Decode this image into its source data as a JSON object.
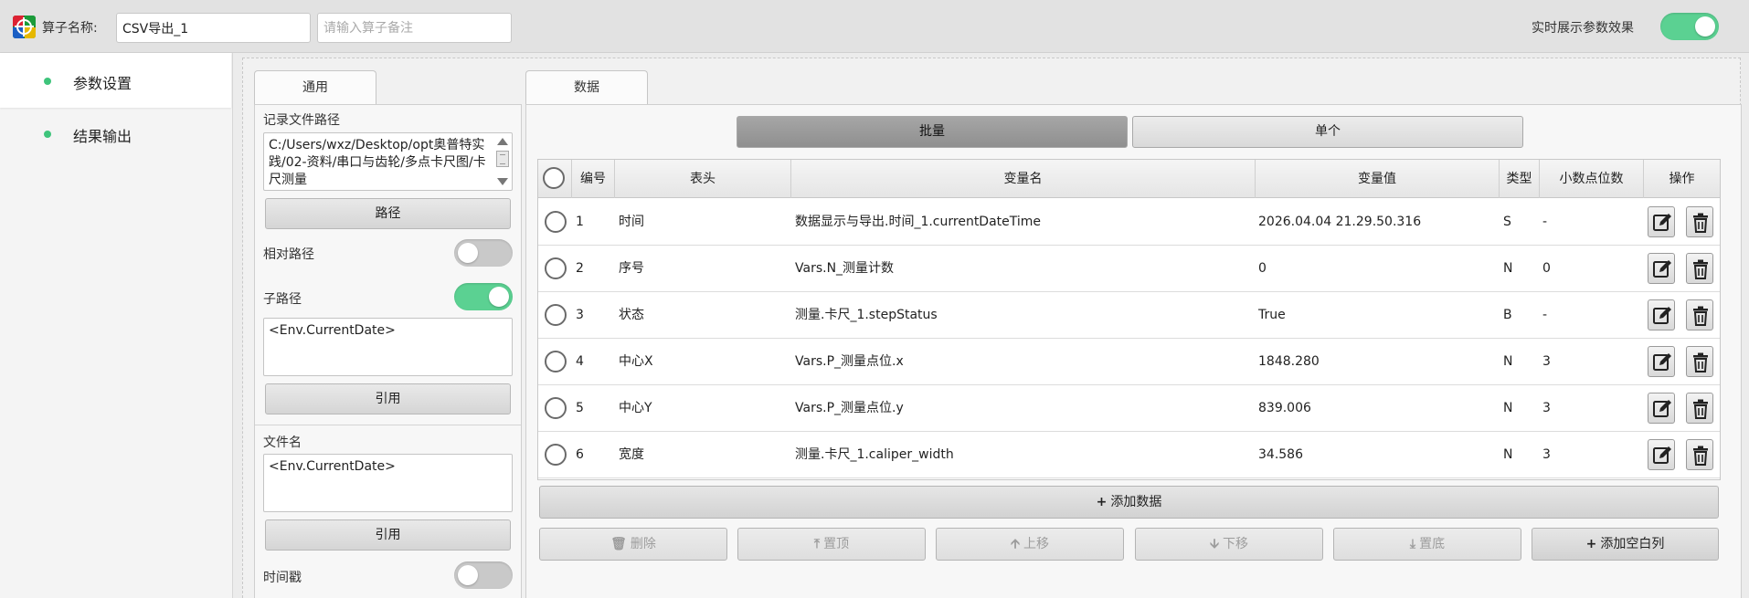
{
  "header": {
    "operator_label": "算子名称:",
    "operator_name": "CSV导出_1",
    "note_placeholder": "请输入算子备注",
    "realtime_label": "实时展示参数效果",
    "realtime_on": true
  },
  "sidebar": {
    "items": [
      {
        "label": "参数设置",
        "active": true
      },
      {
        "label": "结果输出",
        "active": false
      }
    ]
  },
  "left_panel": {
    "tab": "通用",
    "record_path_label": "记录文件路径",
    "record_path_value": "C:/Users/wxz/Desktop/opt奥普特实践/02-资料/串口与齿轮/多点卡尺图/卡尺测量",
    "path_button": "路径",
    "relative_path_label": "相对路径",
    "relative_path_on": false,
    "subpath_label": "子路径",
    "subpath_on": true,
    "subpath_value": "<Env.CurrentDate>",
    "ref_button_1": "引用",
    "filename_label": "文件名",
    "filename_value": "<Env.CurrentDate>",
    "ref_button_2": "引用",
    "timestamp_label": "时间戳",
    "timestamp_on": false
  },
  "right_panel": {
    "tab": "数据",
    "mode_batch": "批量",
    "mode_single": "单个",
    "columns": [
      "编号",
      "表头",
      "变量名",
      "变量值",
      "类型",
      "小数点位数",
      "操作"
    ],
    "rows": [
      {
        "no": "1",
        "header": "时间",
        "var": "数据显示与导出.时间_1.currentDateTime",
        "value": "2026.04.04 21.29.50.316",
        "type": "S",
        "decimals": "-"
      },
      {
        "no": "2",
        "header": "序号",
        "var": "Vars.N_测量计数",
        "value": "0",
        "type": "N",
        "decimals": "0"
      },
      {
        "no": "3",
        "header": "状态",
        "var": "测量.卡尺_1.stepStatus",
        "value": "True",
        "type": "B",
        "decimals": "-"
      },
      {
        "no": "4",
        "header": "中心X",
        "var": "Vars.P_测量点位.x",
        "value": "1848.280",
        "type": "N",
        "decimals": "3"
      },
      {
        "no": "5",
        "header": "中心Y",
        "var": "Vars.P_测量点位.y",
        "value": "839.006",
        "type": "N",
        "decimals": "3"
      },
      {
        "no": "6",
        "header": "宽度",
        "var": "测量.卡尺_1.caliper_width",
        "value": "34.586",
        "type": "N",
        "decimals": "3"
      }
    ],
    "add_data": "添加数据",
    "actions": {
      "delete": "删除",
      "top": "置顶",
      "up": "上移",
      "down": "下移",
      "bottom": "置底",
      "add_blank": "添加空白列"
    }
  },
  "colors": {
    "toggle_on": "#5bd192",
    "sidebar_dot": "#3ec47b"
  }
}
